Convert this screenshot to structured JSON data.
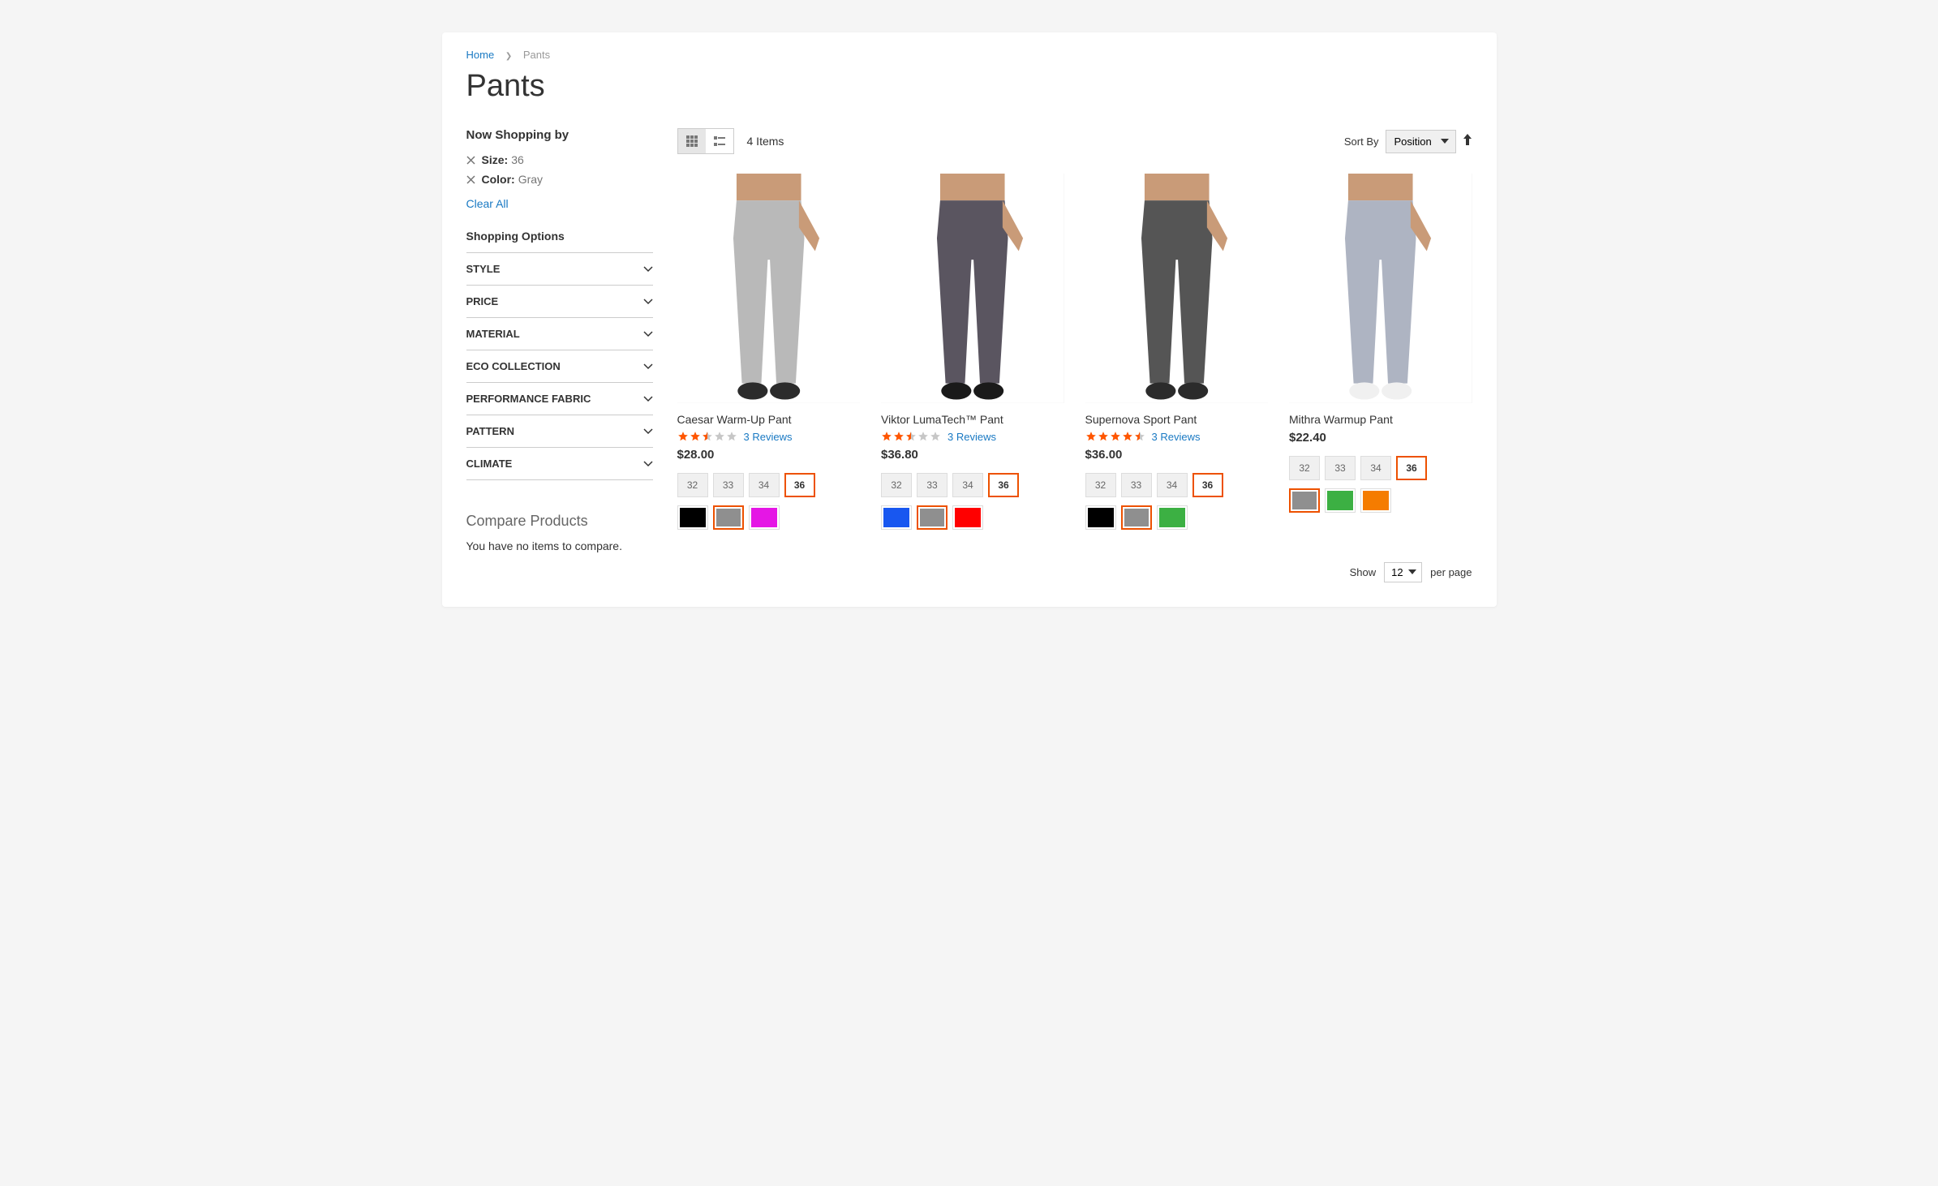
{
  "breadcrumbs": {
    "home": "Home",
    "current": "Pants"
  },
  "page_title": "Pants",
  "sidebar": {
    "now_shopping_title": "Now Shopping by",
    "filters": [
      {
        "label": "Size:",
        "value": "36"
      },
      {
        "label": "Color:",
        "value": "Gray"
      }
    ],
    "clear_all": "Clear All",
    "shopping_options_title": "Shopping Options",
    "options": [
      "STYLE",
      "PRICE",
      "MATERIAL",
      "ECO COLLECTION",
      "PERFORMANCE FABRIC",
      "PATTERN",
      "CLIMATE"
    ],
    "compare_title": "Compare Products",
    "compare_empty": "You have no items to compare."
  },
  "toolbar": {
    "item_count": "4 Items",
    "sort_by_label": "Sort By",
    "sort_value": "Position"
  },
  "products": [
    {
      "name": "Caesar Warm-Up Pant",
      "rating": 2.5,
      "reviews_text": "3  Reviews",
      "price": "$28.00",
      "sizes": [
        "32",
        "33",
        "34",
        "36"
      ],
      "selected_size": "36",
      "colors": [
        "#000000",
        "#8f8f8f",
        "#e516e5"
      ],
      "selected_color": 1,
      "image_pant": "#B9B9B9",
      "image_foot": "#2b2b2b"
    },
    {
      "name": "Viktor LumaTech™ Pant",
      "rating": 2.5,
      "reviews_text": "3  Reviews",
      "price": "$36.80",
      "sizes": [
        "32",
        "33",
        "34",
        "36"
      ],
      "selected_size": "36",
      "colors": [
        "#1857f0",
        "#8f8f8f",
        "#ff0000"
      ],
      "selected_color": 1,
      "image_pant": "#5a5560",
      "image_foot": "#1a1a1a"
    },
    {
      "name": "Supernova Sport Pant",
      "rating": 4.5,
      "reviews_text": "3  Reviews",
      "price": "$36.00",
      "sizes": [
        "32",
        "33",
        "34",
        "36"
      ],
      "selected_size": "36",
      "colors": [
        "#000000",
        "#8f8f8f",
        "#3cb043"
      ],
      "selected_color": 1,
      "image_pant": "#555555",
      "image_foot": "#2b2b2b"
    },
    {
      "name": "Mithra Warmup Pant",
      "rating": 0,
      "reviews_text": "",
      "price": "$22.40",
      "sizes": [
        "32",
        "33",
        "34",
        "36"
      ],
      "selected_size": "36",
      "colors": [
        "#8f8f8f",
        "#3cb043",
        "#f57c00"
      ],
      "selected_color": 0,
      "image_pant": "#aeb4c2",
      "image_foot": "#f0f0f0"
    }
  ],
  "bottom": {
    "show_label": "Show",
    "per_page_value": "12",
    "per_page_suffix": "per page"
  }
}
